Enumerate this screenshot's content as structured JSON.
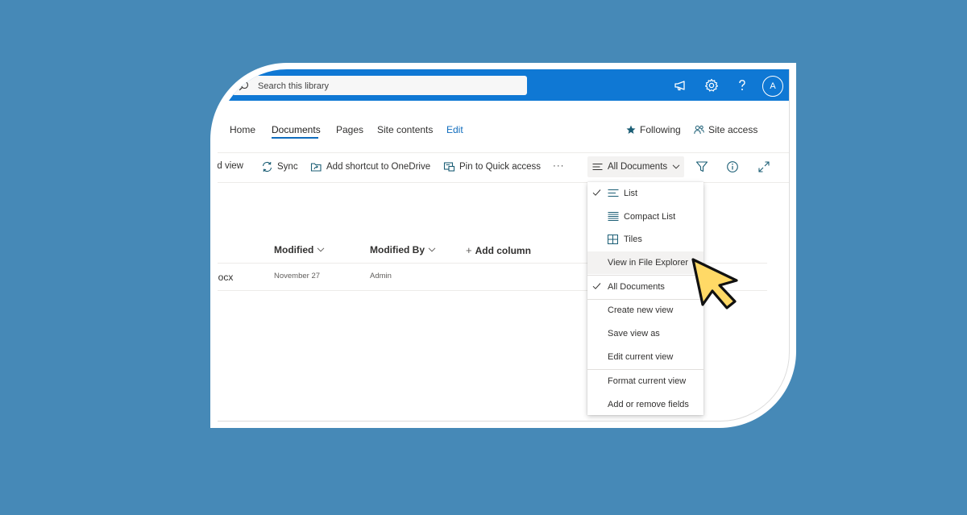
{
  "search": {
    "placeholder": "Search this library"
  },
  "topbar": {
    "icons": [
      "megaphone-icon",
      "gear-icon",
      "help-icon"
    ],
    "avatar_initial": "A",
    "bar_color": "#0f78d4"
  },
  "nav": {
    "items": [
      {
        "label": "Home"
      },
      {
        "label": "Documents",
        "active": true
      },
      {
        "label": "Pages"
      },
      {
        "label": "Site contents"
      },
      {
        "label": "Edit"
      }
    ],
    "following": "Following",
    "site_access": "Site access"
  },
  "commands": {
    "grid_view": "rid view",
    "sync": "Sync",
    "add_shortcut": "Add shortcut to OneDrive",
    "pin": "Pin to Quick access",
    "more": "···",
    "view": "All Documents"
  },
  "columns": {
    "modified": "Modified",
    "modified_by": "Modified By",
    "add_column": "Add column"
  },
  "rows": [
    {
      "name": "locx",
      "modified": "November 27",
      "modified_by": "Admin"
    }
  ],
  "view_menu": {
    "items": [
      {
        "label": "List",
        "icon": "list-icon",
        "checked": true
      },
      {
        "label": "Compact List",
        "icon": "compact-list-icon",
        "checked": false
      },
      {
        "label": "Tiles",
        "icon": "tiles-icon",
        "checked": false
      },
      {
        "label": "View in File Explorer",
        "checked": false,
        "hovered": true
      },
      {
        "label": "All Documents",
        "checked": true
      },
      {
        "label": "Create new view",
        "checked": false
      },
      {
        "label": "Save view as",
        "checked": false
      },
      {
        "label": "Edit current view",
        "checked": false
      },
      {
        "label": "Format current view",
        "checked": false
      },
      {
        "label": "Add or remove fields",
        "checked": false
      }
    ]
  },
  "colors": {
    "background": "#4689b7",
    "accent": "#0f6cbd",
    "cursor": "#ffd966"
  }
}
